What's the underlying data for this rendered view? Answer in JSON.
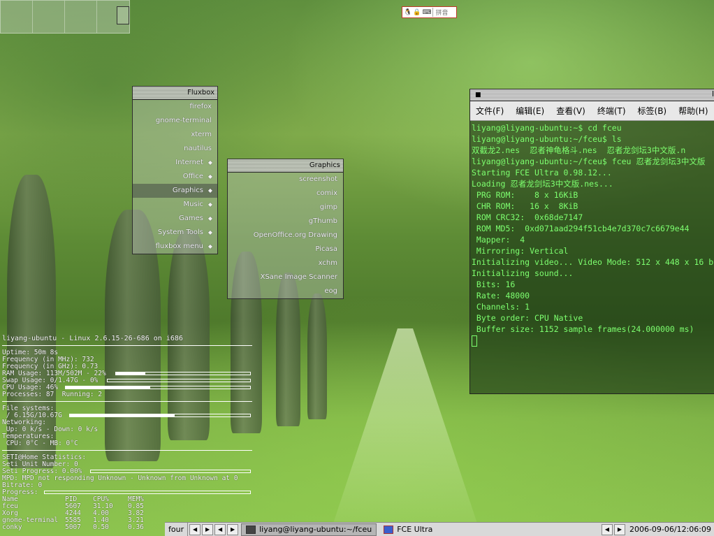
{
  "desktop": {
    "ime": {
      "text": "拼音"
    }
  },
  "fluxbox_menu": {
    "title": "Fluxbox",
    "items": [
      {
        "label": "firefox",
        "sub": false
      },
      {
        "label": "gnome-terminal",
        "sub": false
      },
      {
        "label": "xterm",
        "sub": false
      },
      {
        "label": "nautilus",
        "sub": false
      },
      {
        "label": "Internet",
        "sub": true
      },
      {
        "label": "Office",
        "sub": true
      },
      {
        "label": "Graphics",
        "sub": true,
        "active": true
      },
      {
        "label": "Music",
        "sub": true
      },
      {
        "label": "Games",
        "sub": true
      },
      {
        "label": "System Tools",
        "sub": true
      },
      {
        "label": "fluxbox menu",
        "sub": true
      }
    ]
  },
  "graphics_menu": {
    "title": "Graphics",
    "items": [
      "screenshot",
      "comix",
      "gimp",
      "gThumb",
      "OpenOffice.org Drawing",
      "Picasa",
      "xchm",
      "XSane Image Scanner",
      "eog"
    ]
  },
  "terminal": {
    "title_right": "l",
    "menu": [
      "文件(F)",
      "编辑(E)",
      "查看(V)",
      "终端(T)",
      "标签(B)",
      "帮助(H)"
    ],
    "lines": [
      "liyang@liyang-ubuntu:~$ cd fceu",
      "liyang@liyang-ubuntu:~/fceu$ ls",
      "双截龙2.nes  忍者神龟格斗.nes  忍者龙剑坛3中文版.n",
      "liyang@liyang-ubuntu:~/fceu$ fceu 忍者龙剑坛3中文版",
      "",
      "Starting FCE Ultra 0.98.12...",
      "Loading 忍者龙剑坛3中文版.nes...",
      "",
      " PRG ROM:    8 x 16KiB",
      " CHR ROM:   16 x  8KiB",
      " ROM CRC32:  0x68de7147",
      " ROM MD5:  0xd071aad294f51cb4e7d370c7c6679e44",
      " Mapper:  4",
      " Mirroring: Vertical",
      "",
      "Initializing video... Video Mode: 512 x 448 x 16 b",
      "",
      "Initializing sound...",
      " Bits: 16",
      " Rate: 48000",
      " Channels: 1",
      " Byte order: CPU Native",
      " Buffer size: 1152 sample frames(24.000000 ms)"
    ]
  },
  "conky": {
    "header": "liyang-ubuntu - Linux 2.6.15-26-686 on i686",
    "uptime": "Uptime: 50m 8s",
    "freq_mhz": "Frequency (in MHz): 732",
    "freq_ghz": "Frequency (in GHz): 0.73",
    "ram": "RAM Usage: 113M/502M - 22%",
    "ram_pct": 22,
    "swap": "Swap Usage: 0/1.47G - 0%",
    "swap_pct": 0,
    "cpu": "CPU Usage: 46%",
    "cpu_pct": 46,
    "processes": "Processes: 87  Running: 2",
    "fs_label": "File systems:",
    "fs": " / 6.15G/10.67G",
    "fs_pct": 58,
    "net_label": "Networking:",
    "net": " Up: 0 k/s - Down: 0 k/s",
    "temp_label": "Temperatures:",
    "temp": " CPU: 0°C - MB: 0°C",
    "seti_label": "SETI@Home Statistics:",
    "seti_unit": "Seti Unit Number: 0",
    "seti_progress": "Seti Progress: 0.00%",
    "seti_pct": 0,
    "mpd": "MPD: MPD not responding Unknown - Unknown from Unknown at 0",
    "bitrate": "Bitrate: 0",
    "progress": "Progress:",
    "progress_pct": 0,
    "proc_header": [
      "Name",
      "PID",
      "CPU%",
      "MEM%"
    ],
    "procs": [
      [
        "fceu",
        "5607",
        "31.10",
        "0.85"
      ],
      [
        "Xorg",
        "4244",
        "4.00",
        "3.82"
      ],
      [
        "gnome-terminal",
        "5585",
        "1.40",
        "3.21"
      ],
      [
        "conky",
        "5007",
        "0.50",
        "0.36"
      ]
    ]
  },
  "taskbar": {
    "workspace": "four",
    "tasks": [
      {
        "label": "liyang@liyang-ubuntu:~/fceu",
        "active": true
      },
      {
        "label": "FCE Ultra",
        "active": false
      }
    ],
    "clock": "2006-09-06/12:06:09"
  }
}
